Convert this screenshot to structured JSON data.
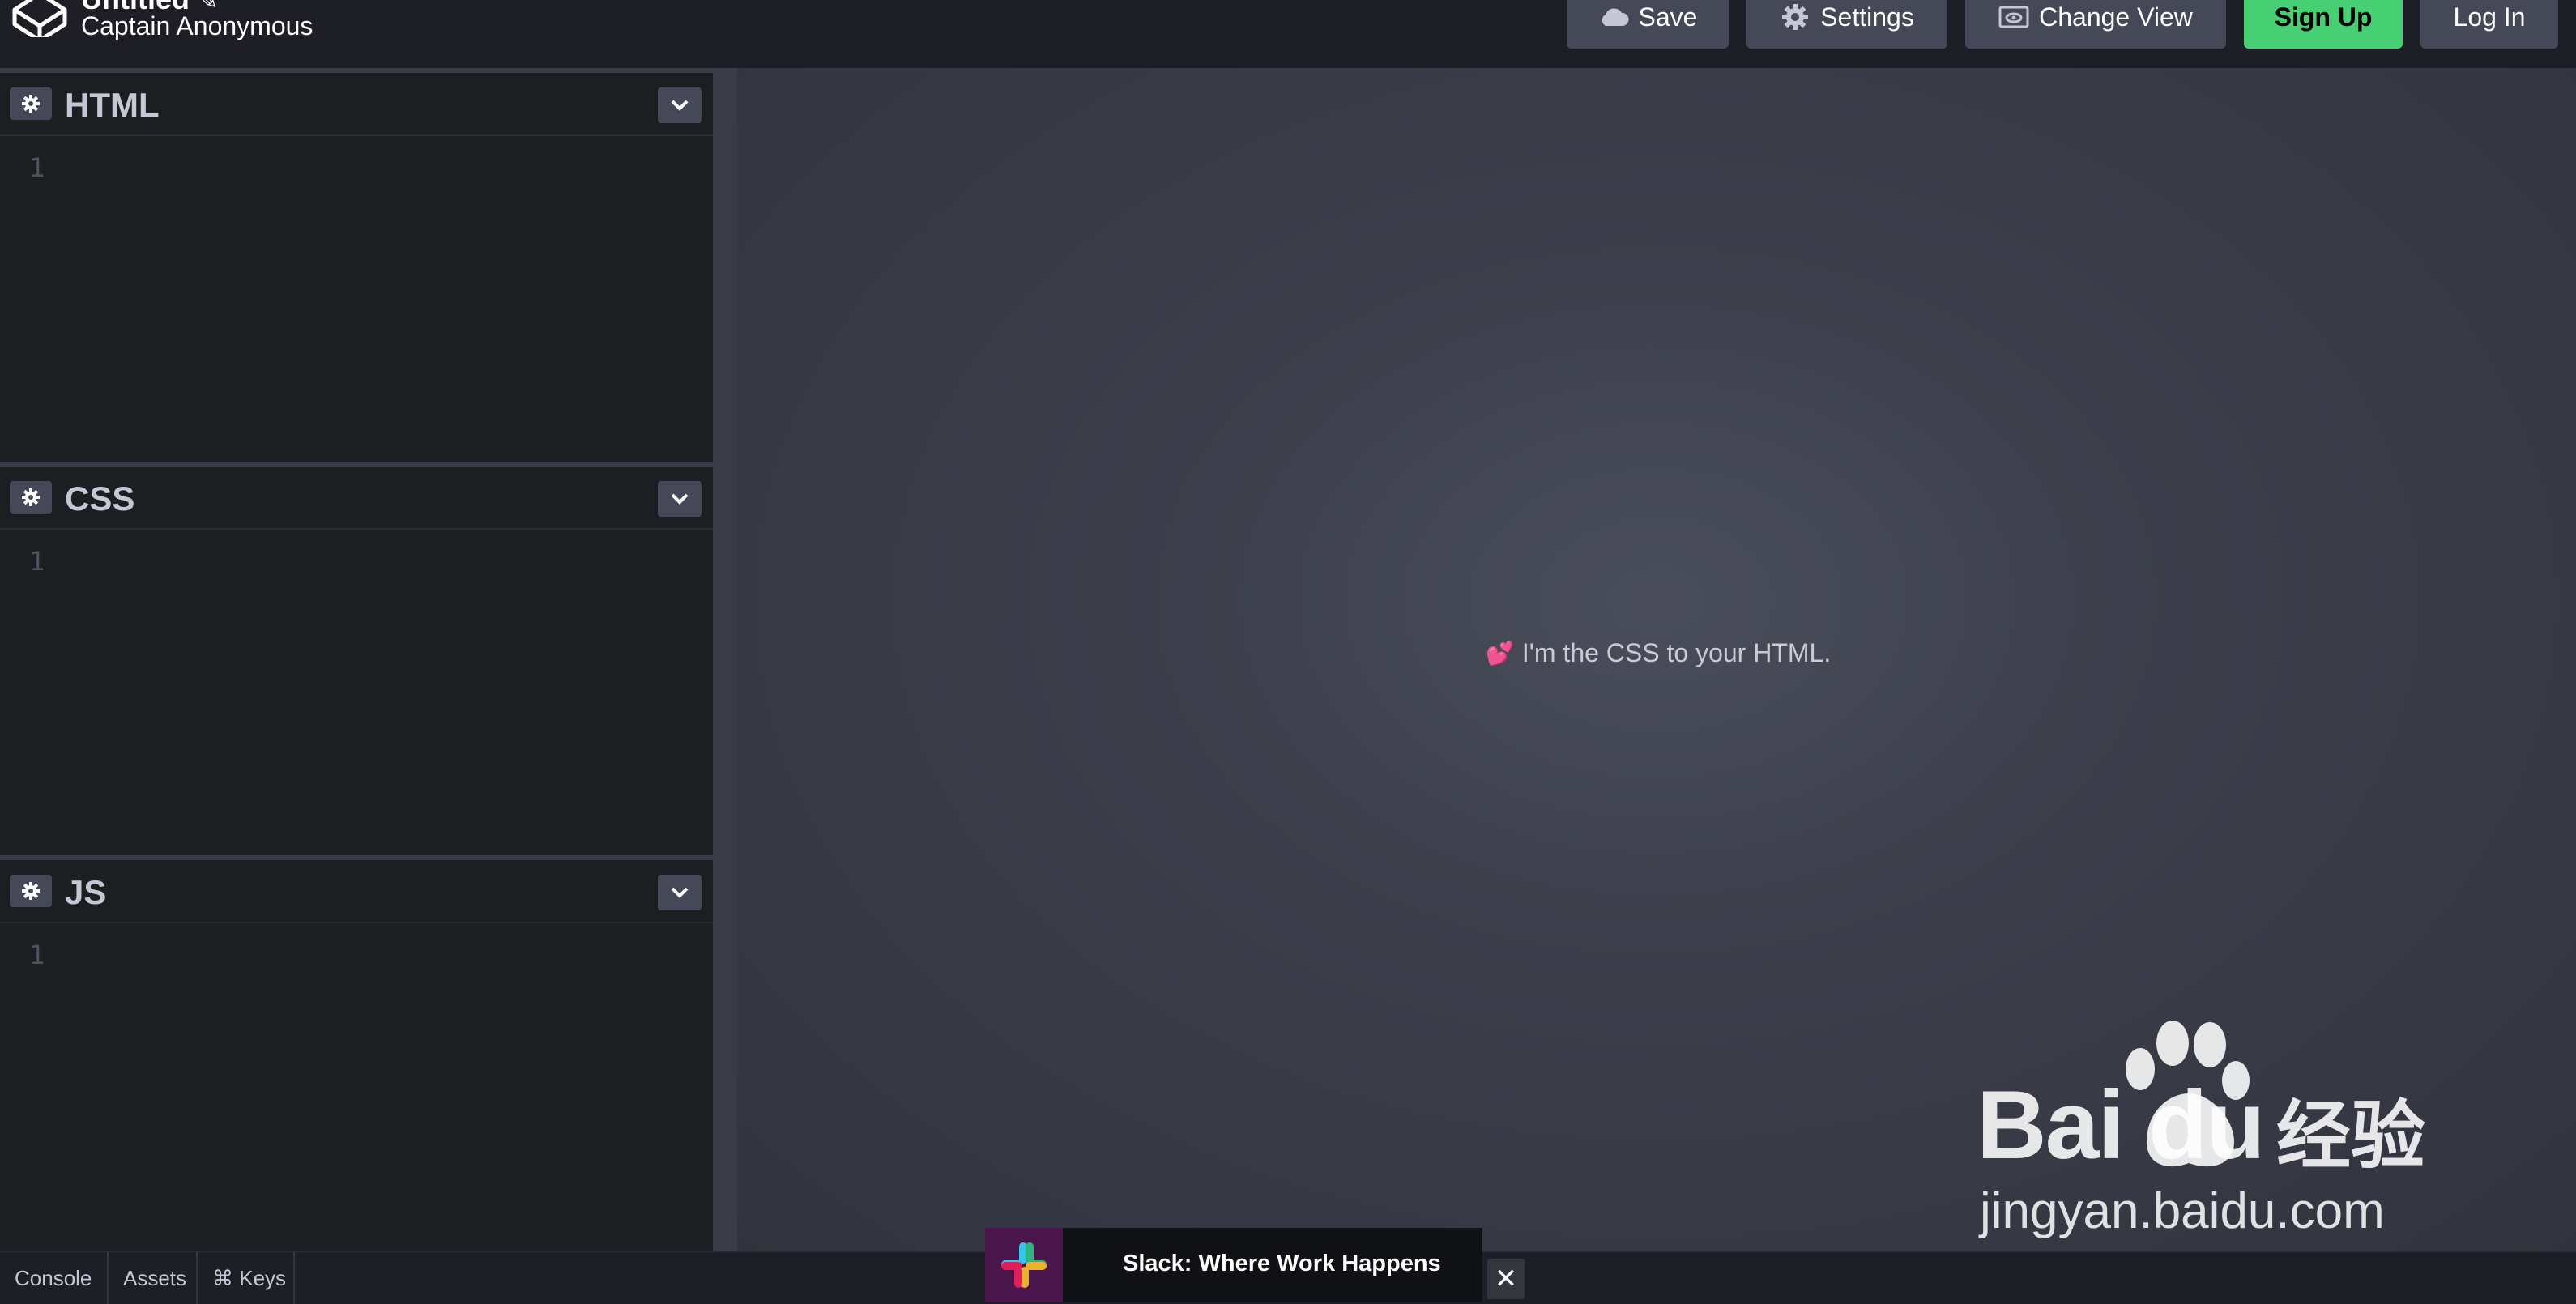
{
  "header": {
    "pen_title": "Untitled",
    "pen_title_edit_icon": "pencil-icon",
    "author": "Captain Anonymous",
    "buttons": {
      "save": "Save",
      "settings": "Settings",
      "change_view": "Change View",
      "sign_up": "Sign Up",
      "log_in": "Log In"
    }
  },
  "editors": [
    {
      "title": "HTML",
      "line": "1"
    },
    {
      "title": "CSS",
      "line": "1"
    },
    {
      "title": "JS",
      "line": "1"
    }
  ],
  "preview": {
    "message": "I'm the CSS to your HTML.",
    "emoji": "💕"
  },
  "bottombar": {
    "console": "Console",
    "assets": "Assets",
    "keys": "⌘ Keys"
  },
  "ad": {
    "text": "Slack: Where Work Happens",
    "close": "✕"
  },
  "watermark": {
    "brand": "Bai du",
    "cn": "经验",
    "url": "jingyan.baidu.com"
  },
  "colors": {
    "accent_green": "#47cf73",
    "button_bg": "#444857",
    "editor_bg": "#1d1e22",
    "header_bg": "#1e1f26"
  }
}
